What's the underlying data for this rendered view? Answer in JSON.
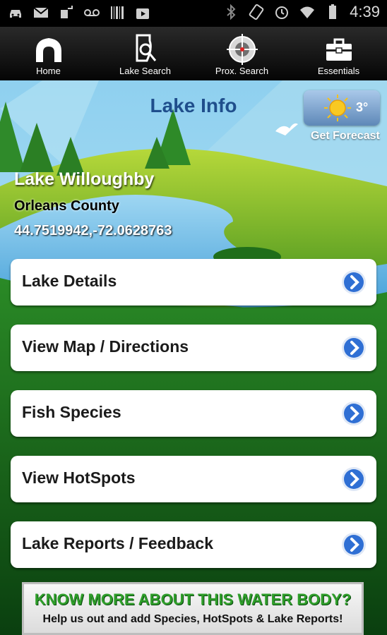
{
  "status_bar": {
    "time": "4:39",
    "left_icons": [
      "car-icon",
      "gmail-icon",
      "usb-icon",
      "voicemail-icon",
      "barcode-icon",
      "play-store-icon"
    ],
    "right_icons": [
      "bluetooth-icon",
      "rotate-icon",
      "alarm-icon",
      "wifi-icon",
      "battery-icon"
    ]
  },
  "tabs": [
    {
      "label": "Home",
      "icon": "home-icon"
    },
    {
      "label": "Lake Search",
      "icon": "lake-search-icon"
    },
    {
      "label": "Prox. Search",
      "icon": "crosshair-icon"
    },
    {
      "label": "Essentials",
      "icon": "toolbox-icon"
    }
  ],
  "header": {
    "title": "Lake Info"
  },
  "weather": {
    "temp": "3°",
    "icon": "sun-icon",
    "forecast_label": "Get Forecast"
  },
  "lake": {
    "name": "Lake Willoughby",
    "county": "Orleans County",
    "coords": "44.7519942,-72.0628763"
  },
  "menu": [
    {
      "label": "Lake Details"
    },
    {
      "label": "View Map / Directions"
    },
    {
      "label": "Fish Species"
    },
    {
      "label": "View HotSpots"
    },
    {
      "label": "Lake Reports / Feedback"
    }
  ],
  "banner": {
    "headline": "KNOW MORE ABOUT THIS WATER BODY?",
    "subline": "Help us out and add Species, HotSpots & Lake Reports!"
  },
  "colors": {
    "title": "#1f4e8c",
    "accent_blue": "#2f6fd4",
    "banner_green": "#2f9e2a"
  }
}
